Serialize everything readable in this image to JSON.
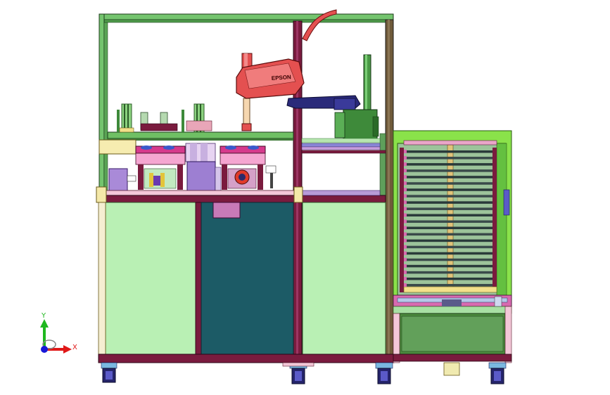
{
  "viewport": {
    "background": "#ffffff"
  },
  "robot": {
    "brand_label": "EPSON",
    "color": "#e24b4b"
  },
  "triad": {
    "x_label": "X",
    "y_label": "Y",
    "x_color": "#e01818",
    "y_color": "#1fb81f",
    "origin_color": "#1818d8"
  },
  "colors": {
    "frame_green": "#74c46e",
    "frame_maroon": "#7a1b3e",
    "panel_light_green": "#b9f0b4",
    "panel_teal": "#1c5b66",
    "magazine_bright_green": "#8ae24a",
    "wheel_blue": "#25246b"
  }
}
